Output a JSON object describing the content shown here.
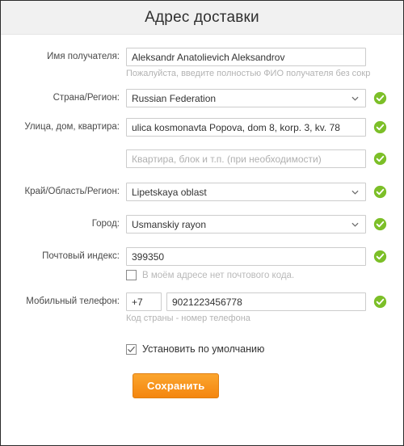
{
  "header": {
    "title": "Адрес доставки"
  },
  "form": {
    "recipient": {
      "label": "Имя получателя:",
      "value": "Aleksandr Anatolievich Aleksandrov",
      "hint": "Пожалуйста, введите полностью ФИО получателя без сокр"
    },
    "country": {
      "label": "Страна/Регион:",
      "value": "Russian Federation"
    },
    "street": {
      "label": "Улица, дом, квартира:",
      "value": "ulica kosmonavta Popova, dom 8, korp. 3, kv. 78"
    },
    "apartment": {
      "placeholder": "Квартира, блок и т.п. (при необходимости)",
      "value": ""
    },
    "region": {
      "label": "Край/Область/Регион:",
      "value": "Lipetskaya oblast"
    },
    "city": {
      "label": "Город:",
      "value": "Usmanskiy rayon"
    },
    "postal": {
      "label": "Почтовый индекс:",
      "value": "399350",
      "no_code_label": "В моём адресе нет почтового кода."
    },
    "phone": {
      "label": "Мобильный телефон:",
      "country_code": "+7",
      "number": "9021223456778",
      "hint": "Код страны - номер телефона"
    },
    "set_default_label": "Установить по умолчанию",
    "save_label": "Сохранить"
  },
  "icons": {
    "valid": "check-circle-icon",
    "chevron": "chevron-down-icon"
  },
  "colors": {
    "accent_button": "#f4860f",
    "valid_green": "#7cbf28",
    "header_bg": "#f1f1f1"
  }
}
